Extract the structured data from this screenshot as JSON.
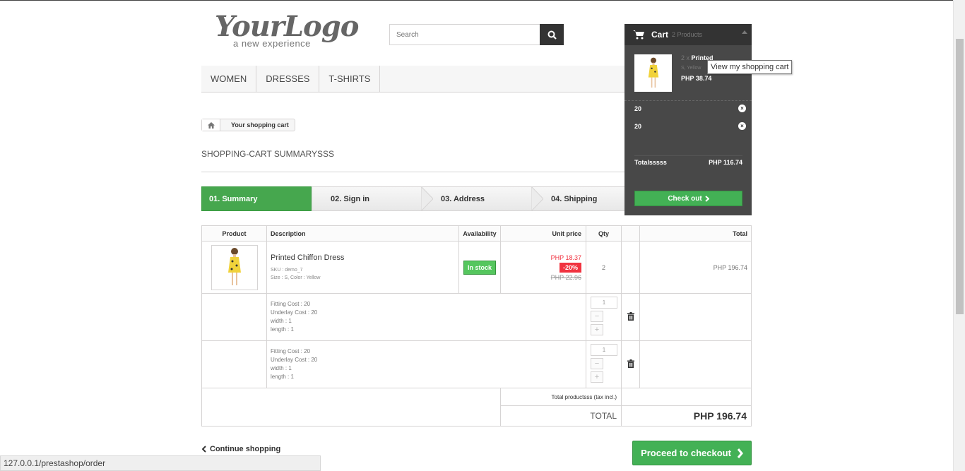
{
  "header": {
    "logo_main": "YourLogo",
    "logo_tagline": "a new experience",
    "search_placeholder": "Search"
  },
  "nav": {
    "items": [
      "WOMEN",
      "DRESSES",
      "T-SHIRTS"
    ]
  },
  "breadcrumb": {
    "current": "Your shopping cart"
  },
  "page_heading": "SHOPPING-CART SUMMARYSSS",
  "steps": [
    {
      "label": "01. Summary",
      "active": true
    },
    {
      "label": "02. Sign in",
      "active": false
    },
    {
      "label": "03. Address",
      "active": false
    },
    {
      "label": "04. Shipping",
      "active": false
    }
  ],
  "table": {
    "headers": [
      "Product",
      "Description",
      "Availability",
      "Unit price",
      "Qty",
      "",
      "Total"
    ],
    "product": {
      "name": "Printed Chiffon Dress",
      "sku": "SKU : demo_7",
      "attributes": "Size : S, Color : Yellow",
      "availability": "In stock",
      "price_discounted": "PHP 18.37",
      "discount": "-20%",
      "price_old": "PHP 22.96",
      "qty": "2",
      "total": "PHP 196.74"
    },
    "customizations": [
      {
        "fitting": "Fitting Cost : 20",
        "underlay": "Underlay Cost : 20",
        "width": "width : 1",
        "length": "length : 1",
        "qty": "1"
      },
      {
        "fitting": "Fitting Cost : 20",
        "underlay": "Underlay Cost : 20",
        "width": "width : 1",
        "length": "length : 1",
        "qty": "1"
      }
    ],
    "total_products_label": "Total productsss (tax incl.)",
    "total_label": "TOTAL",
    "total_value": "PHP 196.74"
  },
  "continue_shopping": "Continue shopping",
  "proceed_checkout": "Proceed to checkout",
  "status_url": "127.0.0.1/prestashop/order",
  "cart_dropdown": {
    "title": "Cart",
    "count": "2 Products",
    "item_qty": "2 x",
    "item_name": "Printed",
    "item_attr": "S, Yellow",
    "item_price": "PHP 38.74",
    "options": [
      "20",
      "20"
    ],
    "total_label": "Totalsssss",
    "total_value": "PHP 116.74",
    "checkout_label": "Check out"
  },
  "tooltip": "View my shopping cart",
  "colors": {
    "accent_green": "#46a74e",
    "discount_red": "#f13340",
    "cart_bg": "#484848"
  }
}
